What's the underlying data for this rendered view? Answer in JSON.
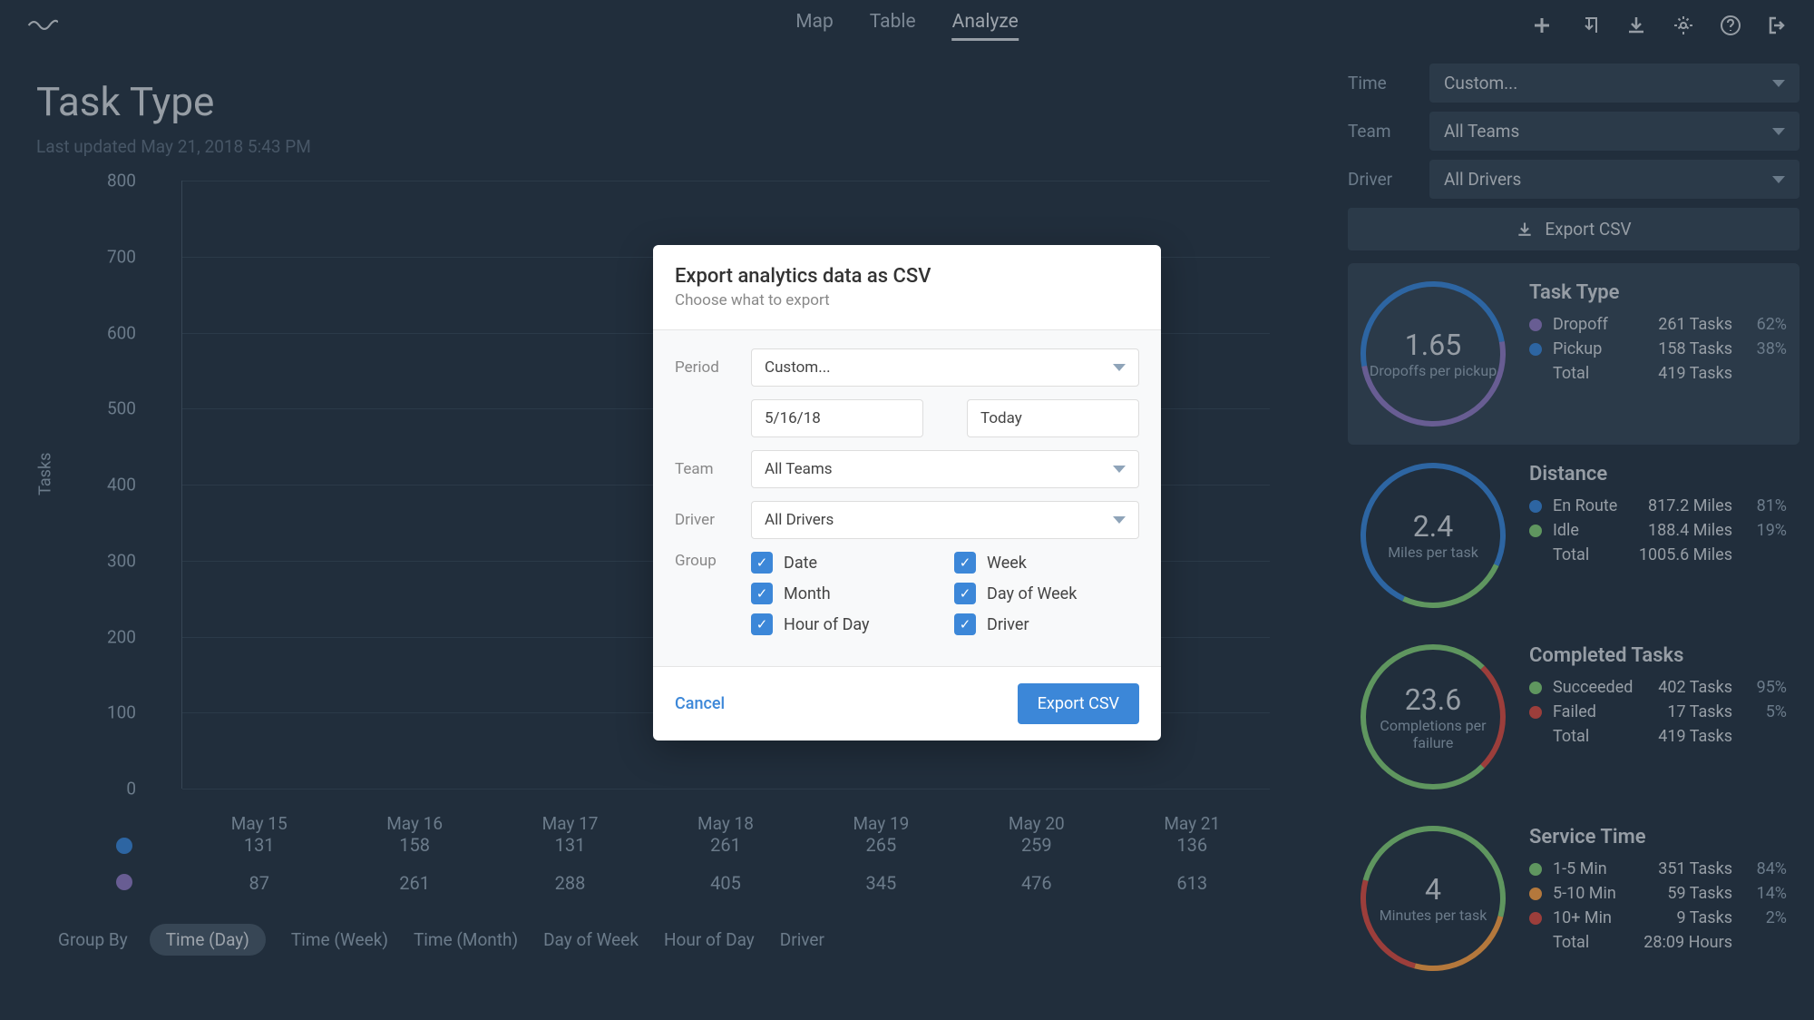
{
  "nav": {
    "map": "Map",
    "table": "Table",
    "analyze": "Analyze"
  },
  "page": {
    "title": "Task Type",
    "updated": "Last updated May 21, 2018 5:43 PM",
    "y_title": "Tasks"
  },
  "chart_data": {
    "type": "bar",
    "categories": [
      "May 15",
      "May 16",
      "May 17",
      "May 18",
      "May 19",
      "May 20",
      "May 21"
    ],
    "series": [
      {
        "name": "Pickup",
        "color": "#3c87d8",
        "values": [
          131,
          158,
          131,
          261,
          265,
          259,
          136
        ]
      },
      {
        "name": "Dropoff",
        "color": "#8b7cc4",
        "values": [
          87,
          261,
          288,
          405,
          345,
          476,
          613
        ]
      }
    ],
    "ylim": [
      0,
      800
    ],
    "yticks": [
      0,
      100,
      200,
      300,
      400,
      500,
      600,
      700,
      800
    ]
  },
  "groupby": {
    "label": "Group By",
    "options": [
      "Time (Day)",
      "Time (Week)",
      "Time (Month)",
      "Day of Week",
      "Hour of Day",
      "Driver"
    ],
    "active": 0
  },
  "filters": {
    "time_label": "Time",
    "time_value": "Custom...",
    "team_label": "Team",
    "team_value": "All Teams",
    "driver_label": "Driver",
    "driver_value": "All Drivers",
    "export": "Export CSV"
  },
  "cards": {
    "task_type": {
      "title": "Task Type",
      "val": "1.65",
      "sub": "Dropoffs per pickup",
      "rows": [
        {
          "c": "#8b7cc4",
          "l": "Dropoff",
          "v": "261 Tasks",
          "p": "62%"
        },
        {
          "c": "#3c87d8",
          "l": "Pickup",
          "v": "158 Tasks",
          "p": "38%"
        }
      ],
      "total_l": "Total",
      "total_v": "419 Tasks"
    },
    "distance": {
      "title": "Distance",
      "val": "2.4",
      "sub": "Miles per task",
      "rows": [
        {
          "c": "#3c87d8",
          "l": "En Route",
          "v": "817.2 Miles",
          "p": "81%"
        },
        {
          "c": "#7fc97f",
          "l": "Idle",
          "v": "188.4 Miles",
          "p": "19%"
        }
      ],
      "total_l": "Total",
      "total_v": "1005.6 Miles"
    },
    "completed": {
      "title": "Completed Tasks",
      "val": "23.6",
      "sub": "Completions per failure",
      "rows": [
        {
          "c": "#7fc97f",
          "l": "Succeeded",
          "v": "402 Tasks",
          "p": "95%"
        },
        {
          "c": "#d0534f",
          "l": "Failed",
          "v": "17 Tasks",
          "p": "5%"
        }
      ],
      "total_l": "Total",
      "total_v": "419 Tasks"
    },
    "service": {
      "title": "Service Time",
      "val": "4",
      "sub": "Minutes per task",
      "rows": [
        {
          "c": "#7fc97f",
          "l": "1-5 Min",
          "v": "351 Tasks",
          "p": "84%"
        },
        {
          "c": "#f0a050",
          "l": "5-10 Min",
          "v": "59 Tasks",
          "p": "14%"
        },
        {
          "c": "#d0534f",
          "l": "10+ Min",
          "v": "9 Tasks",
          "p": "2%"
        }
      ],
      "total_l": "Total",
      "total_v": "28:09 Hours"
    }
  },
  "modal": {
    "title": "Export analytics data as CSV",
    "sub": "Choose what to export",
    "period_l": "Period",
    "period_v": "Custom...",
    "from": "5/16/18",
    "to": "Today",
    "team_l": "Team",
    "team_v": "All Teams",
    "driver_l": "Driver",
    "driver_v": "All Drivers",
    "group_l": "Group",
    "checks": [
      "Date",
      "Week",
      "Month",
      "Day of Week",
      "Hour of Day",
      "Driver"
    ],
    "cancel": "Cancel",
    "confirm": "Export CSV"
  }
}
